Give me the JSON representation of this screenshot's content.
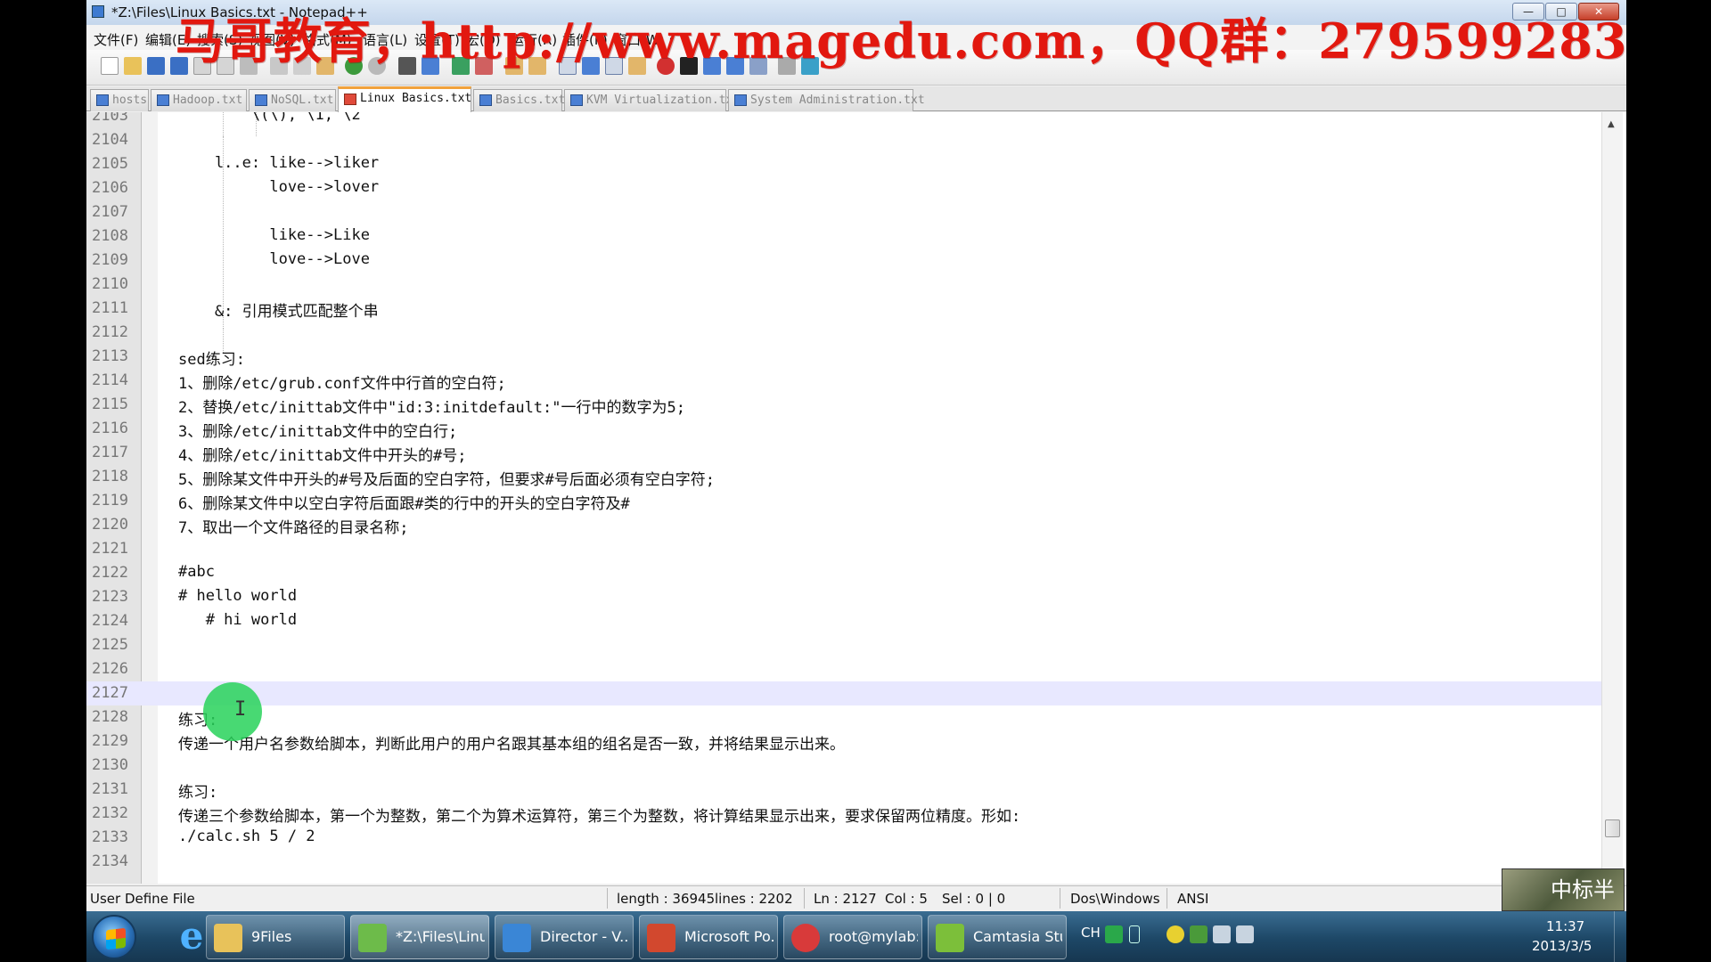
{
  "window": {
    "title": "*Z:\\Files\\Linux Basics.txt - Notepad++",
    "watermark": "马哥教育，http://www.magedu.com，QQ群：279599283",
    "buttons": {
      "minimize": "—",
      "maximize": "□",
      "close": "✕"
    }
  },
  "menu": [
    "文件(F)",
    "编辑(E)",
    "搜索(S)",
    "视图(V)",
    "格式(M)",
    "语言(L)",
    "设置(T)",
    "宏(O)",
    "运行(R)",
    "插件(P)",
    "窗口(W)",
    "?"
  ],
  "tabs": [
    {
      "label": "hosts"
    },
    {
      "label": "Hadoop.txt"
    },
    {
      "label": "NoSQL.txt"
    },
    {
      "label": "Linux Basics.txt",
      "active": true
    },
    {
      "label": "Basics.txt"
    },
    {
      "label": "KVM Virtualization.txt"
    },
    {
      "label": "System Administration.txt"
    }
  ],
  "editor": {
    "current_line": "2127",
    "lines": [
      {
        "num": "2103",
        "text": "        \\(\\), \\1, \\2"
      },
      {
        "num": "2104",
        "text": ""
      },
      {
        "num": "2105",
        "text": "    l..e: like-->liker"
      },
      {
        "num": "2106",
        "text": "          love-->lover"
      },
      {
        "num": "2107",
        "text": ""
      },
      {
        "num": "2108",
        "text": "          like-->Like"
      },
      {
        "num": "2109",
        "text": "          love-->Love"
      },
      {
        "num": "2110",
        "text": ""
      },
      {
        "num": "2111",
        "text": "    &: 引用模式匹配整个串"
      },
      {
        "num": "2112",
        "text": ""
      },
      {
        "num": "2113",
        "text": "sed练习:"
      },
      {
        "num": "2114",
        "text": "1、删除/etc/grub.conf文件中行首的空白符;"
      },
      {
        "num": "2115",
        "text": "2、替换/etc/inittab文件中\"id:3:initdefault:\"一行中的数字为5;"
      },
      {
        "num": "2116",
        "text": "3、删除/etc/inittab文件中的空白行;"
      },
      {
        "num": "2117",
        "text": "4、删除/etc/inittab文件中开头的#号;"
      },
      {
        "num": "2118",
        "text": "5、删除某文件中开头的#号及后面的空白字符，但要求#号后面必须有空白字符;"
      },
      {
        "num": "2119",
        "text": "6、删除某文件中以空白字符后面跟#类的行中的开头的空白字符及#"
      },
      {
        "num": "2120",
        "text": "7、取出一个文件路径的目录名称;"
      },
      {
        "num": "2121",
        "text": ""
      },
      {
        "num": "2122",
        "text": "#abc"
      },
      {
        "num": "2123",
        "text": "# hello world"
      },
      {
        "num": "2124",
        "text": "   # hi world"
      },
      {
        "num": "2125",
        "text": ""
      },
      {
        "num": "2126",
        "text": ""
      },
      {
        "num": "2127",
        "text": ""
      },
      {
        "num": "2128",
        "text": "练习:"
      },
      {
        "num": "2129",
        "text": "传递一个用户名参数给脚本，判断此用户的用户名跟其基本组的组名是否一致，并将结果显示出来。"
      },
      {
        "num": "2130",
        "text": ""
      },
      {
        "num": "2131",
        "text": "练习:"
      },
      {
        "num": "2132",
        "text": "传递三个参数给脚本，第一个为整数，第二个为算术运算符，第三个为整数，将计算结果显示出来，要求保留两位精度。形如:"
      },
      {
        "num": "2133",
        "text": "./calc.sh 5 / 2"
      },
      {
        "num": "2134",
        "text": ""
      }
    ],
    "ibeam": "I"
  },
  "status": {
    "file_type": "User Define File",
    "length": "length : 36945",
    "lines": "lines : 2202",
    "ln": "Ln : 2127",
    "col": "Col : 5",
    "sel": "Sel : 0 | 0",
    "eol": "Dos\\Windows",
    "encoding": "ANSI",
    "stamp": "中标半"
  },
  "taskbar": {
    "items": [
      {
        "label": "9Files",
        "icon": "folder-icon",
        "color": "#e8c25a"
      },
      {
        "label": "*Z:\\Files\\Linux...",
        "icon": "notepadpp-icon",
        "color": "#6dbb4a",
        "active": true
      },
      {
        "label": "Director - V...",
        "icon": "vmware-icon",
        "color": "#3a86d6"
      },
      {
        "label": "Microsoft Po...",
        "icon": "powerpoint-icon",
        "color": "#d2482e"
      },
      {
        "label": "root@mylab:...",
        "icon": "xshell-icon",
        "color": "#d83a3a"
      },
      {
        "label": "Camtasia Stu...",
        "icon": "camtasia-icon",
        "color": "#7cbf3a"
      }
    ],
    "tray_lang": "CH",
    "clock_time": "11:37",
    "clock_date": "2013/3/5"
  }
}
